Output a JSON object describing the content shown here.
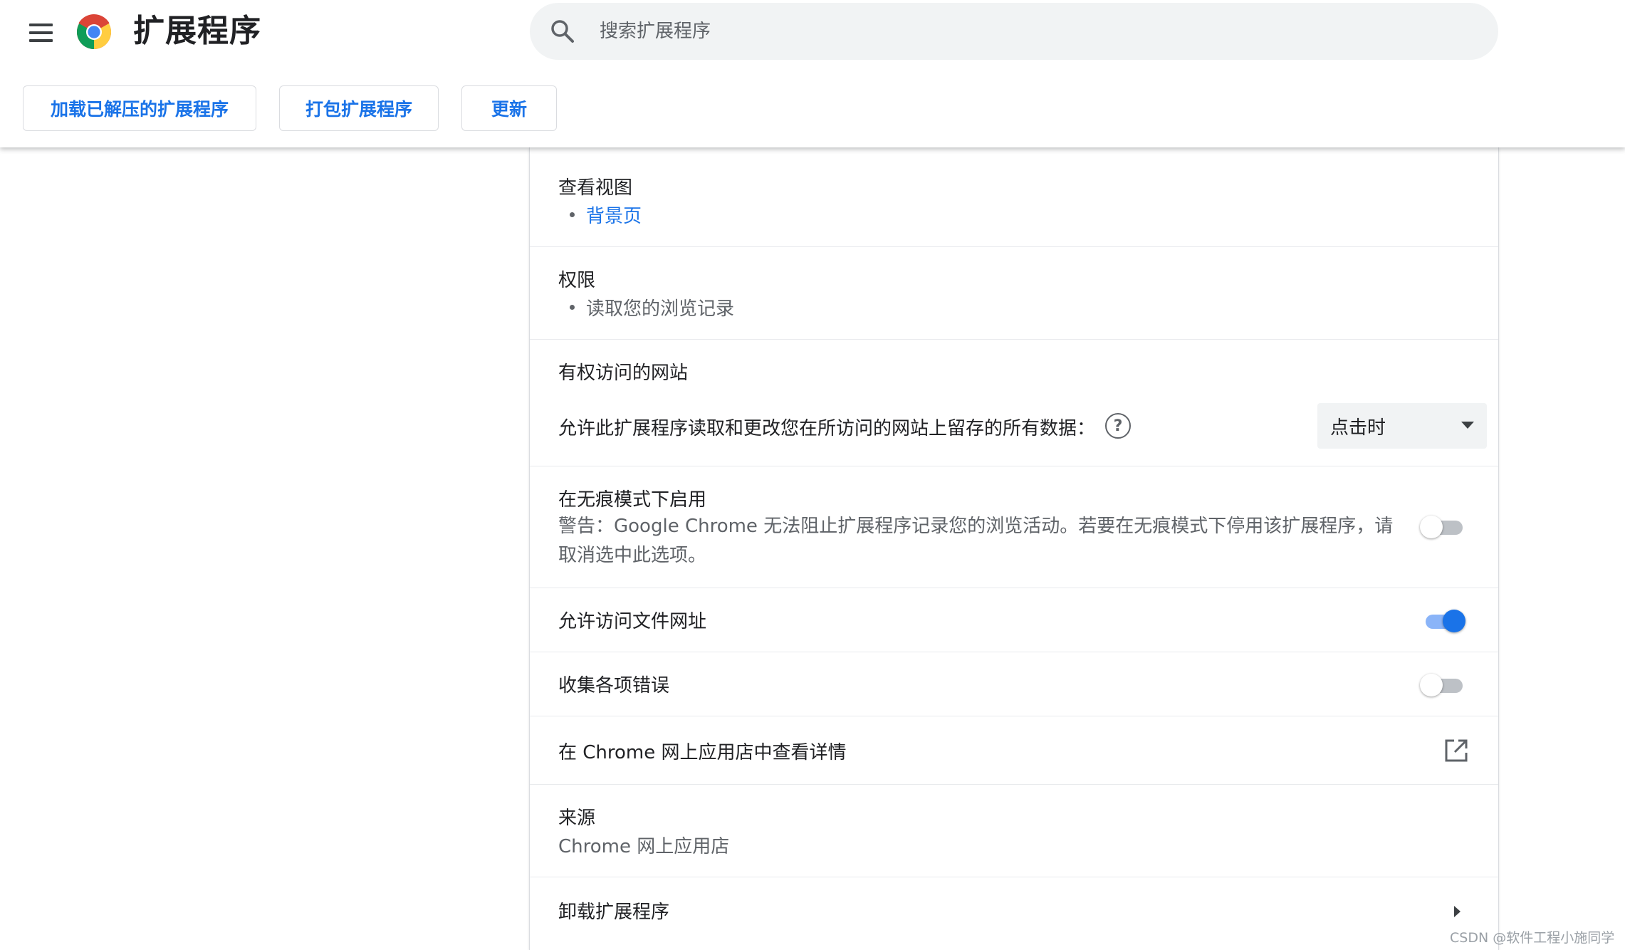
{
  "header": {
    "title": "扩展程序",
    "search_placeholder": "搜索扩展程序",
    "buttons": {
      "load_unpacked": "加载已解压的扩展程序",
      "pack": "打包扩展程序",
      "update": "更新"
    }
  },
  "details": {
    "views": {
      "label": "查看视图",
      "items": [
        "背景页"
      ]
    },
    "permissions": {
      "label": "权限",
      "items": [
        "读取您的浏览记录"
      ]
    },
    "site_access": {
      "label": "有权访问的网站",
      "description": "允许此扩展程序读取和更改您在所访问的网站上留存的所有数据：",
      "help_glyph": "?",
      "selected_option": "点击时"
    },
    "incognito": {
      "label": "在无痕模式下启用",
      "warning": "警告：Google Chrome 无法阻止扩展程序记录您的浏览活动。若要在无痕模式下停用该扩展程序，请取消选中此选项。",
      "enabled": false
    },
    "file_urls": {
      "label": "允许访问文件网址",
      "enabled": true
    },
    "collect_errors": {
      "label": "收集各项错误",
      "enabled": false
    },
    "webstore": {
      "label": "在 Chrome 网上应用店中查看详情"
    },
    "source": {
      "label": "来源",
      "value": "Chrome 网上应用店"
    },
    "uninstall": {
      "label": "卸载扩展程序"
    }
  },
  "watermark": "CSDN @软件工程小施同学",
  "icons": {
    "menu": "hamburger-menu-icon",
    "logo": "chrome-logo-icon",
    "search": "search-icon",
    "help": "help-circle-icon",
    "dropdown": "dropdown-arrow-icon",
    "external": "open-in-new-icon",
    "chevron": "chevron-right-icon"
  },
  "colors": {
    "accent": "#1a73e8",
    "toggle_on_track": "#8ab4f8",
    "toggle_off_track": "#bdc1c6",
    "search_bg": "#f1f3f4"
  }
}
